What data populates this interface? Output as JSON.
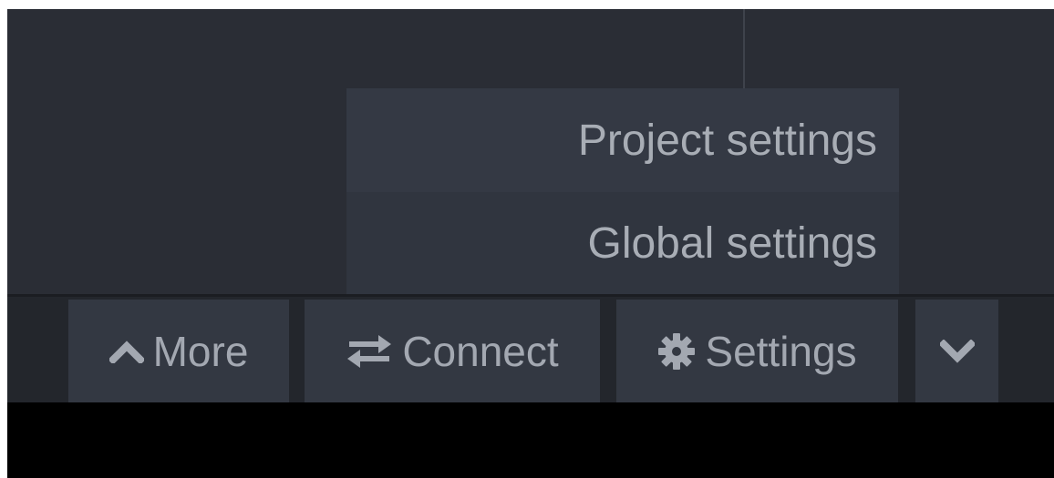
{
  "dropdown": {
    "items": [
      {
        "label": "Project settings"
      },
      {
        "label": "Global settings"
      }
    ]
  },
  "toolbar": {
    "more_label": "More",
    "more_icon": "chevron-up-icon",
    "connect_label": "Connect",
    "connect_icon": "swap-arrows-icon",
    "settings_label": "Settings",
    "settings_icon": "gear-icon",
    "collapse_icon": "chevron-down-icon"
  },
  "colors": {
    "editor_bg": "#2a2d35",
    "menu_bg": "#333842",
    "toolbar_bg": "#23262c",
    "button_bg": "#333842",
    "text": "#a8adb5"
  }
}
